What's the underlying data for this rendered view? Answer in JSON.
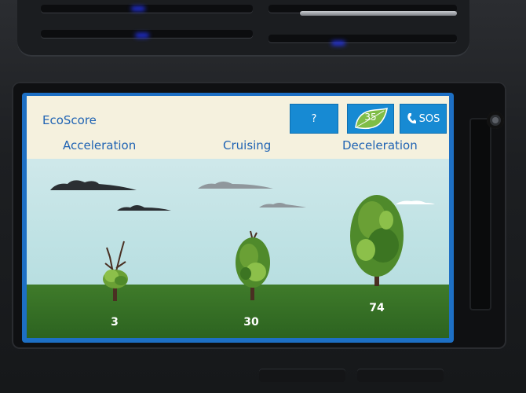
{
  "app": {
    "title": "EcoScore"
  },
  "tabs": [
    {
      "label": "Acceleration"
    },
    {
      "label": "Cruising"
    },
    {
      "label": "Deceleration"
    }
  ],
  "buttons": {
    "help_label": "?",
    "eco_score_label": "35",
    "sos_label": "SOS"
  },
  "scores": [
    {
      "value": "3"
    },
    {
      "value": "30"
    },
    {
      "value": "74"
    }
  ],
  "colors": {
    "accent_blue": "#178ad3",
    "title_blue": "#1f63b3",
    "header_bg": "#f5f1de",
    "sky": "#c4e3e6",
    "grass": "#3a7427"
  }
}
